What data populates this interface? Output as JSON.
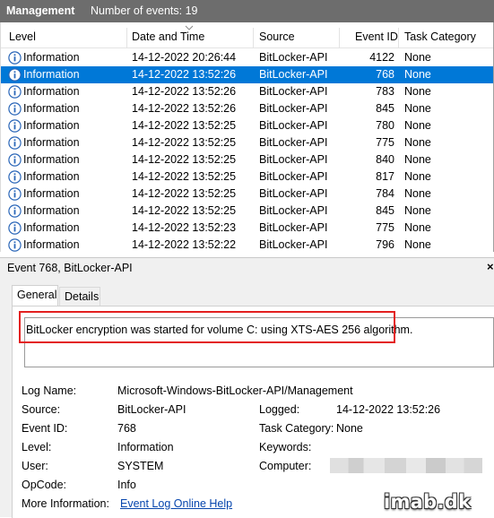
{
  "titlebar": {
    "title": "Management",
    "event_count": "Number of events: 19"
  },
  "columns": {
    "level": "Level",
    "datetime": "Date and Time",
    "source": "Source",
    "event_id": "Event ID",
    "category": "Task Category"
  },
  "events": [
    {
      "level": "Information",
      "datetime": "14-12-2022 20:26:44",
      "source": "BitLocker-API",
      "event_id": "4122",
      "category": "None",
      "selected": false
    },
    {
      "level": "Information",
      "datetime": "14-12-2022 13:52:26",
      "source": "BitLocker-API",
      "event_id": "768",
      "category": "None",
      "selected": true
    },
    {
      "level": "Information",
      "datetime": "14-12-2022 13:52:26",
      "source": "BitLocker-API",
      "event_id": "783",
      "category": "None",
      "selected": false
    },
    {
      "level": "Information",
      "datetime": "14-12-2022 13:52:26",
      "source": "BitLocker-API",
      "event_id": "845",
      "category": "None",
      "selected": false
    },
    {
      "level": "Information",
      "datetime": "14-12-2022 13:52:25",
      "source": "BitLocker-API",
      "event_id": "780",
      "category": "None",
      "selected": false
    },
    {
      "level": "Information",
      "datetime": "14-12-2022 13:52:25",
      "source": "BitLocker-API",
      "event_id": "775",
      "category": "None",
      "selected": false
    },
    {
      "level": "Information",
      "datetime": "14-12-2022 13:52:25",
      "source": "BitLocker-API",
      "event_id": "840",
      "category": "None",
      "selected": false
    },
    {
      "level": "Information",
      "datetime": "14-12-2022 13:52:25",
      "source": "BitLocker-API",
      "event_id": "817",
      "category": "None",
      "selected": false
    },
    {
      "level": "Information",
      "datetime": "14-12-2022 13:52:25",
      "source": "BitLocker-API",
      "event_id": "784",
      "category": "None",
      "selected": false
    },
    {
      "level": "Information",
      "datetime": "14-12-2022 13:52:25",
      "source": "BitLocker-API",
      "event_id": "845",
      "category": "None",
      "selected": false
    },
    {
      "level": "Information",
      "datetime": "14-12-2022 13:52:23",
      "source": "BitLocker-API",
      "event_id": "775",
      "category": "None",
      "selected": false
    },
    {
      "level": "Information",
      "datetime": "14-12-2022 13:52:22",
      "source": "BitLocker-API",
      "event_id": "796",
      "category": "None",
      "selected": false
    }
  ],
  "detail": {
    "title": "Event 768, BitLocker-API",
    "close_label": "×",
    "tabs": [
      "General",
      "Details"
    ],
    "message": "BitLocker encryption was started for volume C: using XTS-AES 256 algorithm.",
    "fields": {
      "log_name_label": "Log Name:",
      "log_name": "Microsoft-Windows-BitLocker-API/Management",
      "source_label": "Source:",
      "source": "BitLocker-API",
      "logged_label": "Logged:",
      "logged": "14-12-2022 13:52:26",
      "event_id_label": "Event ID:",
      "event_id": "768",
      "task_category_label": "Task Category:",
      "task_category": "None",
      "level_label": "Level:",
      "level": "Information",
      "keywords_label": "Keywords:",
      "user_label": "User:",
      "user": "SYSTEM",
      "computer_label": "Computer:",
      "opcode_label": "OpCode:",
      "opcode": "Info",
      "more_info_label": "More Information:",
      "more_info_link": "Event Log Online Help"
    }
  },
  "watermark": "imab.dk",
  "colors": {
    "selection": "#0078d7",
    "titlebar": "#6d6d6d",
    "highlight_box": "#e32020",
    "link": "#0645ad",
    "info_icon": "#2a66b8"
  },
  "icons": {
    "row_level": "information-icon",
    "sort": "sort-descending-icon"
  }
}
